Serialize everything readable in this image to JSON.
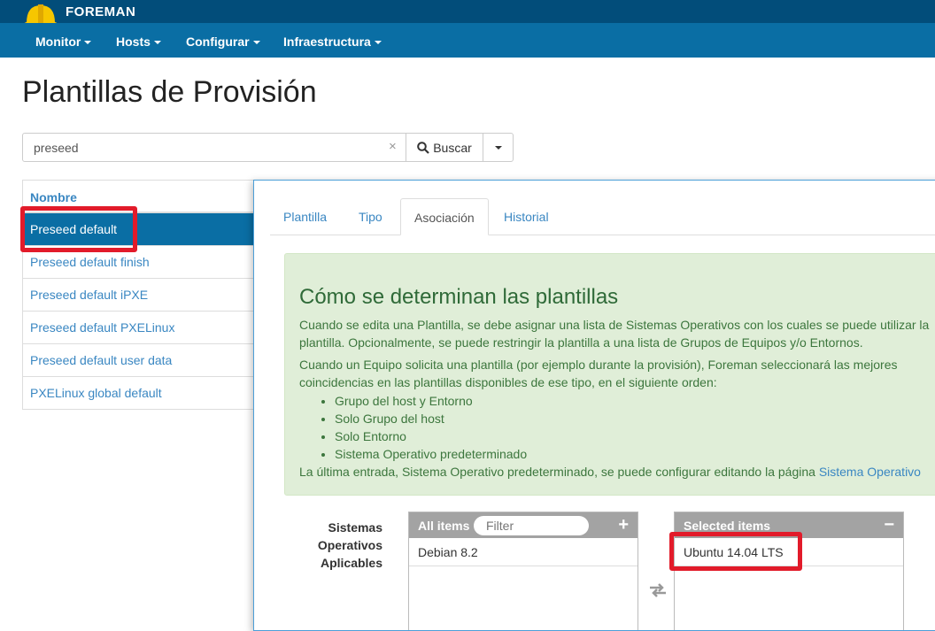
{
  "brand": {
    "name": "FOREMAN"
  },
  "nav": [
    {
      "label": "Monitor"
    },
    {
      "label": "Hosts"
    },
    {
      "label": "Configurar"
    },
    {
      "label": "Infraestructura"
    }
  ],
  "page": {
    "title": "Plantillas de Provisión"
  },
  "search": {
    "value": "preseed",
    "clear": "×",
    "button_label": "Buscar"
  },
  "list": {
    "header": "Nombre",
    "rows": [
      "Preseed default",
      "Preseed default finish",
      "Preseed default iPXE",
      "Preseed default PXELinux",
      "Preseed default user data",
      "PXELinux global default"
    ]
  },
  "tabs": [
    "Plantilla",
    "Tipo",
    "Asociación",
    "Historial"
  ],
  "info": {
    "title": "Cómo se determinan las plantillas",
    "p1_line1": "Cuando se edita una Plantilla, se debe asignar una lista de Sistemas Operativos con los cuales se puede utilizar la",
    "p1_line2": "plantilla. Opcionalmente, se puede restringir la plantilla a una lista de Grupos de Equipos y/o Entornos.",
    "p2_line1": "Cuando un Equipo solicita una plantilla (por ejemplo durante la provisión), Foreman seleccionará las mejores",
    "p2_line2": "coincidencias en las plantillas disponibles de ese tipo, en el siguiente orden:",
    "order": [
      "Grupo del host y Entorno",
      "Solo Grupo del host",
      "Solo Entorno",
      "Sistema Operativo predeterminado"
    ],
    "last_text": "La última entrada, Sistema Operativo predeterminado, se puede configurar editando la página ",
    "last_link": "Sistema Operativo"
  },
  "association": {
    "label_line1": "Sistemas",
    "label_line2": "Operativos",
    "label_line3": "Aplicables",
    "all_items": {
      "title": "All items",
      "filter_placeholder": "Filter",
      "action": "+",
      "items": [
        "Debian 8.2"
      ]
    },
    "selected_items": {
      "title": "Selected items",
      "action": "−",
      "items": [
        "Ubuntu 14.04 LTS"
      ]
    }
  },
  "colors": {
    "brand": "#024d7a",
    "nav": "#0a6ea4",
    "highlight": "#e21b2a",
    "link": "#3a87c2",
    "info_bg": "#e0eed8"
  }
}
